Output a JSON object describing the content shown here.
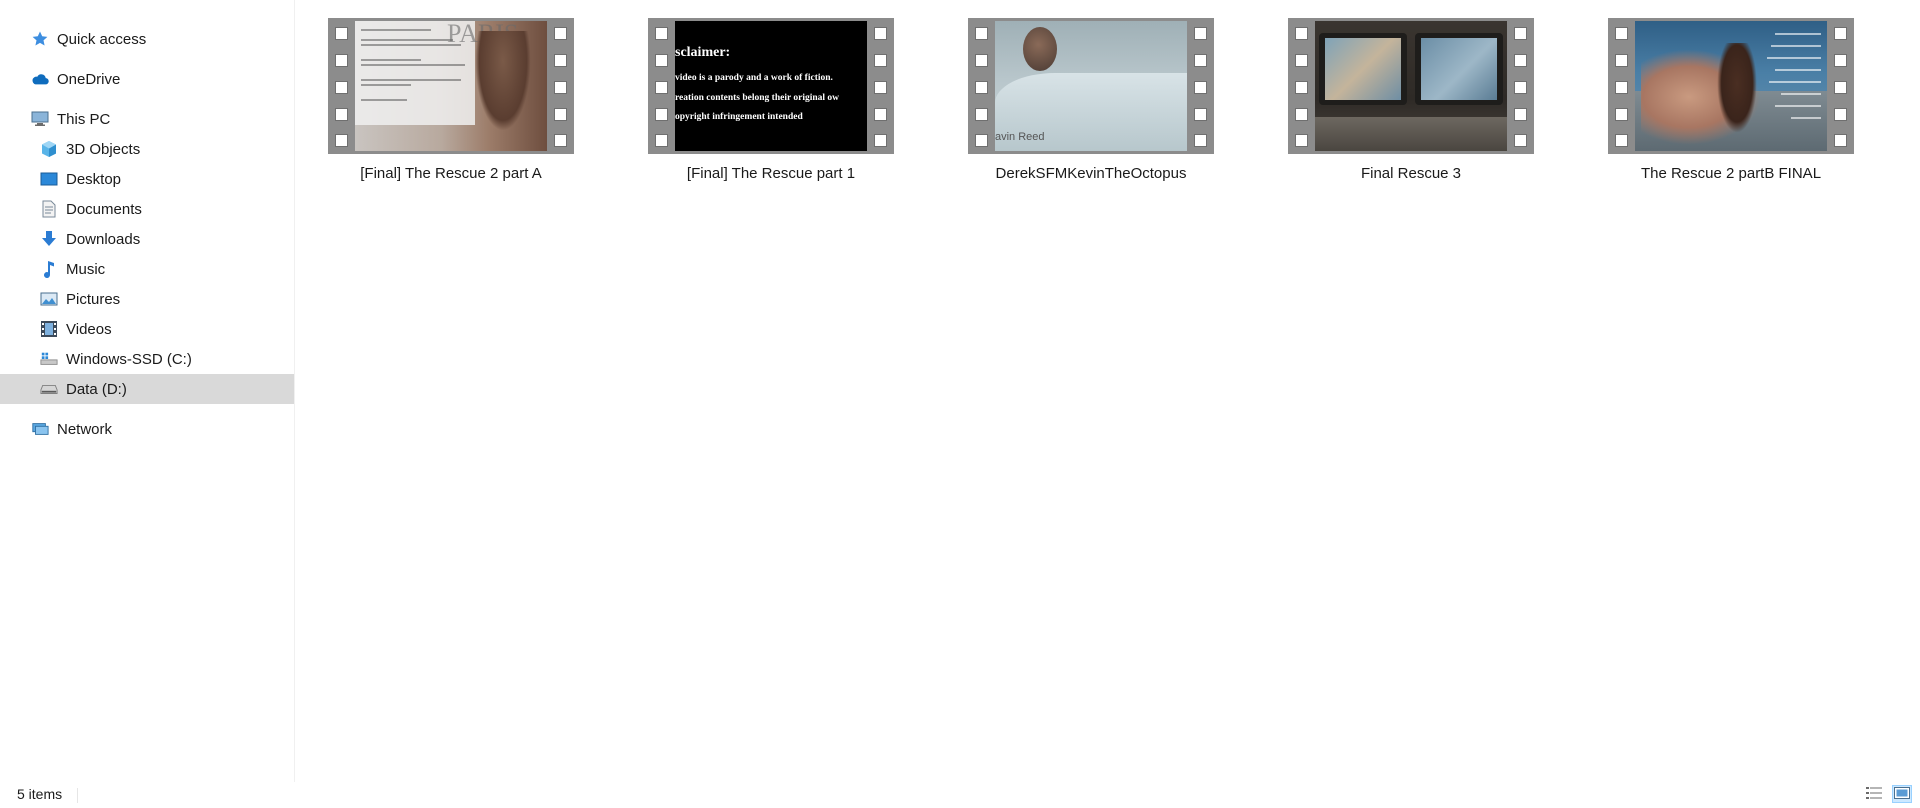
{
  "sidebar": {
    "items": [
      {
        "label": "Quick access",
        "icon": "star-icon",
        "level": 0,
        "selected": false
      },
      {
        "label": "OneDrive",
        "icon": "cloud-icon",
        "level": 0,
        "selected": false
      },
      {
        "label": "This PC",
        "icon": "computer-icon",
        "level": 0,
        "selected": false
      },
      {
        "label": "3D Objects",
        "icon": "cube-icon",
        "level": 1,
        "selected": false
      },
      {
        "label": "Desktop",
        "icon": "desktop-icon",
        "level": 1,
        "selected": false
      },
      {
        "label": "Documents",
        "icon": "document-icon",
        "level": 1,
        "selected": false
      },
      {
        "label": "Downloads",
        "icon": "download-arrow-icon",
        "level": 1,
        "selected": false
      },
      {
        "label": "Music",
        "icon": "music-note-icon",
        "level": 1,
        "selected": false
      },
      {
        "label": "Pictures",
        "icon": "pictures-icon",
        "level": 1,
        "selected": false
      },
      {
        "label": "Videos",
        "icon": "film-strip-icon",
        "level": 1,
        "selected": false
      },
      {
        "label": "Windows-SSD (C:)",
        "icon": "windows-drive-icon",
        "level": 1,
        "selected": false
      },
      {
        "label": "Data (D:)",
        "icon": "drive-icon",
        "level": 1,
        "selected": true
      },
      {
        "label": "Network",
        "icon": "network-icon",
        "level": 0,
        "selected": false
      }
    ]
  },
  "files": [
    {
      "name": "[Final] The Rescue 2 part A",
      "thumbnail": "video-thumbnail-poster"
    },
    {
      "name": "[Final] The Rescue part 1",
      "thumbnail": "video-thumbnail-disclaimer"
    },
    {
      "name": "DerekSFMKevinTheOctopus",
      "thumbnail": "video-thumbnail-bathtub"
    },
    {
      "name": "Final Rescue 3",
      "thumbnail": "video-thumbnail-monitors"
    },
    {
      "name": "The Rescue 2 partB FINAL",
      "thumbnail": "video-thumbnail-boat"
    }
  ],
  "thumb_text": {
    "paris": "PARIS",
    "disclaimer_title": "sclaimer:",
    "disclaimer_line1": "video is a parody and a work of fiction.",
    "disclaimer_line2": "reation contents belong their original ow",
    "disclaimer_line3": "opyright infringement intended",
    "credit": "avin Reed"
  },
  "statusbar": {
    "item_count": "5 items",
    "views": [
      {
        "icon": "details-view-icon",
        "active": false
      },
      {
        "icon": "large-icons-view-icon",
        "active": true
      }
    ]
  },
  "colors": {
    "selection": "#d9d9d9",
    "film_strip": "#8c8c8c",
    "accent": "#0078d7"
  }
}
